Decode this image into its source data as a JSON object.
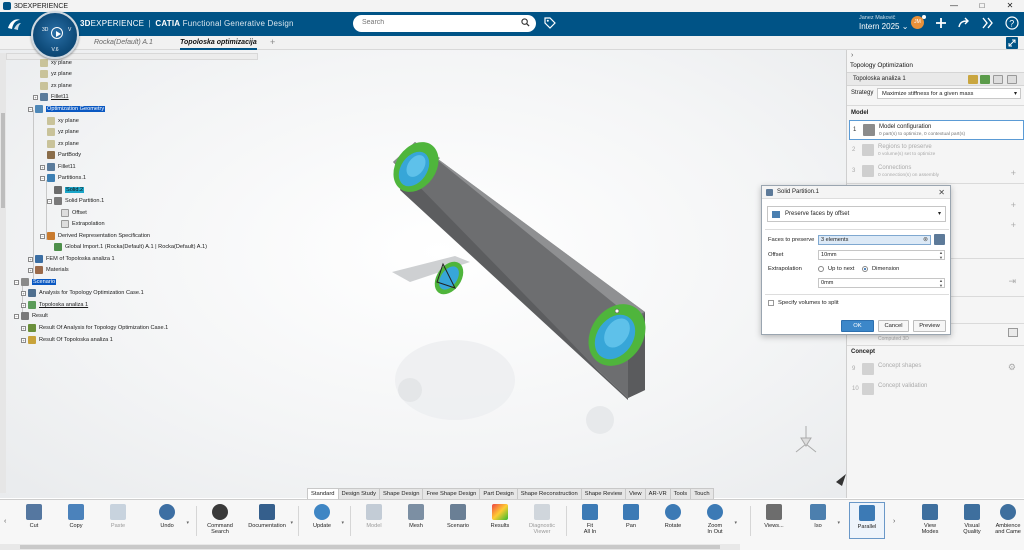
{
  "window": {
    "title": "3DEXPERIENCE",
    "controls": [
      "—",
      "□",
      "✕"
    ]
  },
  "header": {
    "brand_3d": "3D",
    "brand_exp": "EXPERIENCE",
    "brand_sep": "|",
    "brand_catia": "CATIA",
    "brand_app": "Functional Generative Design",
    "search_placeholder": "Search",
    "user_name": "Janez Makovič",
    "tenant": "Intern 2025",
    "avatar_initials": "JM",
    "accent": "#005386"
  },
  "compass": {
    "version": "V.6",
    "q1": "3D",
    "q2": "V"
  },
  "tabs": {
    "doc1": "Rocka(Default) A.1",
    "doc2": "Topoloska optimizacija",
    "plus": "+"
  },
  "tree": {
    "n1": "xy plane",
    "n2": "yz plane",
    "n3": "zx plane",
    "n4": "Fillet11",
    "n5": "Optimization Geometry",
    "n6": "xy plane",
    "n7": "yz plane",
    "n8": "zx plane",
    "n9": "PartBody",
    "n10": "Fillet11",
    "n11": "Partitions.1",
    "n12": "Solid.2",
    "n13": "Solid Partition.1",
    "n14": "Offset",
    "n15": "Extrapolation",
    "n16": "Derived Representation Specification",
    "n17": "Global Import.1 (Rocka(Default) A.1 | Rocka(Default) A.1)",
    "n18": "FEM of Topoloska analiza 1",
    "n19": "Materials",
    "n20": "Scenario",
    "n21": "Analysis for Topology Optimization Case.1",
    "n22": "Topoloska analiza 1",
    "n23": "Result",
    "n24": "Result Of Analysis for Topology Optimization Case.1",
    "n25": "Result Of Topoloska analiza 1"
  },
  "panel": {
    "collapse": "›",
    "title": "Topology Optimization",
    "analysis_name": "Topoloska analiza 1",
    "strategy_label": "Strategy",
    "strategy_value": "Maximize stiffness for a given mass",
    "model_section": "Model",
    "step1_num": "1",
    "step1_title": "Model configuration",
    "step1_desc": "0 part(s) to optimize, 0 contextual part(s)",
    "step2_num": "2",
    "step2_title": "Regions to preserve",
    "step2_desc": "0 volume(s) set to optimize",
    "step3_num": "3",
    "step3_title": "Connections",
    "step3_desc": "0 connection(s) on assembly",
    "computed_label": "Computed 3D",
    "concept_section": "Concept",
    "step9_num": "9",
    "step9_title": "Concept shapes",
    "step10_num": "10",
    "step10_title": "Concept validation"
  },
  "dialog": {
    "title": "Solid Partition.1",
    "close": "✕",
    "mode": "Preserve faces by offset",
    "faces_label": "Faces to preserve",
    "faces_value": "3 elements",
    "offset_label": "Offset",
    "offset_value": "10mm",
    "extrap_label": "Extrapolation",
    "opt_up": "Up to next",
    "opt_dim": "Dimension",
    "dim_value": "0mm",
    "specify_label": "Specify volumes to split",
    "ok": "OK",
    "cancel": "Cancel",
    "preview": "Preview"
  },
  "workbench_tabs": [
    "Standard",
    "Design Study",
    "Shape Design",
    "Free Shape Design",
    "Part Design",
    "Shape Reconstruction",
    "Shape Review",
    "View",
    "AR-VR",
    "Tools",
    "Touch"
  ],
  "actions": {
    "cut": "Cut",
    "copy": "Copy",
    "paste": "Paste",
    "undo": "Undo",
    "cmd1": "Command",
    "cmd2": "Search",
    "documentation": "Documentation",
    "update": "Update",
    "model": "Model",
    "mesh": "Mesh",
    "scenario": "Scenario",
    "results": "Results",
    "diag1": "Diagnostic",
    "diag2": "Viewer",
    "fit1": "Fit",
    "fit2": "All In",
    "pan": "Pan",
    "rotate": "Rotate",
    "zoom1": "Zoom",
    "zoom2": "In Out",
    "views": "Views...",
    "iso": "Iso",
    "parallel": "Parallel",
    "view1": "View",
    "view2": "Modes",
    "visual1": "Visual",
    "visual2": "Quality",
    "amb1": "Ambience",
    "amb2": "and Came"
  }
}
